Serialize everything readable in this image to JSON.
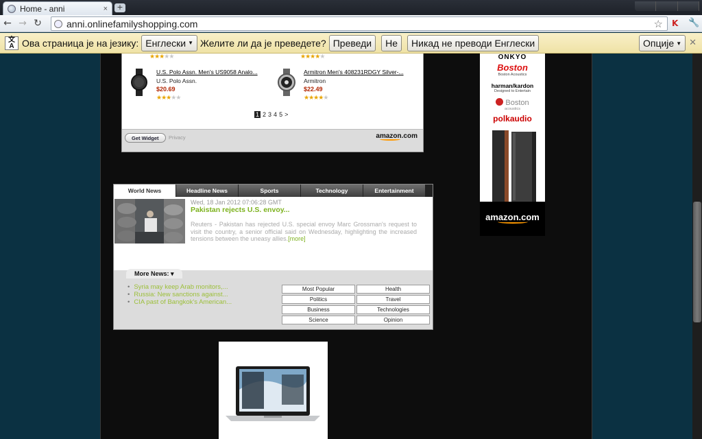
{
  "browser": {
    "tab_title": "Home - anni",
    "tab_close": "×",
    "new_tab": "+",
    "url": "anni.onlinefamilyshopping.com",
    "nav": {
      "back": "←",
      "forward": "→",
      "reload": "↻"
    },
    "star": "☆",
    "ext": "K",
    "wrench": "🔧"
  },
  "translate_bar": {
    "message": "Ова страница је на језику:",
    "language": "Енглески",
    "question": "Желите ли да је преведете?",
    "translate_button": "Преведи",
    "no_button": "Не",
    "never_button": "Никад не преводи Енглески",
    "options_button": "Опције",
    "close": "✕"
  },
  "amazon_widget": {
    "products": [
      {
        "title": "U.S. Polo Assn. Men's US9058 Analo...",
        "brand": "U.S. Polo Assn.",
        "price": "$20.69",
        "rating": 3
      },
      {
        "title": "Armitron Men's 408231RDGY Silver-...",
        "brand": "Armitron",
        "price": "$22.49",
        "rating": 4.5
      }
    ],
    "top_ratings": [
      3,
      4
    ],
    "pager": {
      "current": "1",
      "pages": [
        "2",
        "3",
        "4",
        "5"
      ],
      "next": ">"
    },
    "get_widget": "Get Widget",
    "privacy": "Privacy",
    "logo": "amazon.com"
  },
  "ad_panel": {
    "brands": [
      "ONKYO",
      "Boston",
      "Boston Acoustics",
      "harman/kardon",
      "Designed to Entertain",
      "Boston",
      "acoustics",
      "polkaudio"
    ],
    "logo": "amazon.com"
  },
  "news": {
    "tabs": [
      "World News",
      "Headline News",
      "Sports",
      "Technology",
      "Entertainment"
    ],
    "active_tab": 0,
    "date": "Wed, 18 Jan 2012 07:06:28 GMT",
    "title": "Pakistan rejects U.S. envoy...",
    "body": "Reuters - Pakistan has rejected U.S. special envoy Marc Grossman's request to visit the country, a senior official said on Wednesday, highlighting the increased tensions between the uneasy allies.",
    "more_link": "[more]",
    "more_news_label": "More News:",
    "more_news_caret": "▾",
    "headlines": [
      "Syria may keep Arab monitors,...",
      "Russia: New sanctions against...",
      "CIA past of Bangkok's American..."
    ],
    "categories": [
      "Most Popular",
      "Health",
      "Politics",
      "Travel",
      "Business",
      "Technologies",
      "Science",
      "Opinion"
    ]
  },
  "colors": {
    "page_bg": "#0b3142",
    "column_bg": "#0d0d0d",
    "news_green": "#7db21e",
    "price_red": "#b12704",
    "star_gold": "#e8a500",
    "amazon_orange": "#ff9900"
  }
}
